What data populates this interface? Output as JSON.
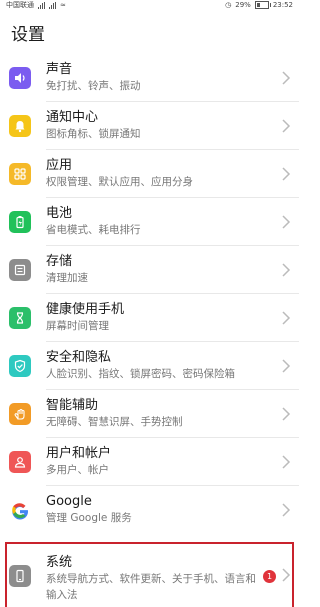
{
  "status_bar": {
    "carrier": "中国联通",
    "battery": "29%",
    "time": "23:52"
  },
  "page_title": "设置",
  "items": [
    {
      "title": "声音",
      "subtitle": "免打扰、铃声、振动",
      "icon": "sound-icon",
      "color": "#7b5cf0"
    },
    {
      "title": "通知中心",
      "subtitle": "图标角标、锁屏通知",
      "icon": "bell-icon",
      "color": "#f5c518"
    },
    {
      "title": "应用",
      "subtitle": "权限管理、默认应用、应用分身",
      "icon": "apps-grid-icon",
      "color": "#f5b928"
    },
    {
      "title": "电池",
      "subtitle": "省电模式、耗电排行",
      "icon": "battery-icon",
      "color": "#21c15a"
    },
    {
      "title": "存储",
      "subtitle": "清理加速",
      "icon": "storage-icon",
      "color": "#8d8d8d"
    },
    {
      "title": "健康使用手机",
      "subtitle": "屏幕时间管理",
      "icon": "hourglass-icon",
      "color": "#2bbf6a"
    },
    {
      "title": "安全和隐私",
      "subtitle": "人脸识别、指纹、锁屏密码、密码保险箱",
      "icon": "shield-icon",
      "color": "#2ec9c0"
    },
    {
      "title": "智能辅助",
      "subtitle": "无障碍、智慧识屏、手势控制",
      "icon": "hand-icon",
      "color": "#f29b26"
    },
    {
      "title": "用户和帐户",
      "subtitle": "多用户、帐户",
      "icon": "user-icon",
      "color": "#ef5656"
    },
    {
      "title": "Google",
      "subtitle": "管理 Google 服务",
      "icon": "google-icon",
      "color": "#ffffff"
    }
  ],
  "system": {
    "title": "系统",
    "subtitle": "系统导航方式、软件更新、关于手机、语言和输入法",
    "icon": "phone-icon",
    "color": "#8d8d8d",
    "badge": "1"
  }
}
